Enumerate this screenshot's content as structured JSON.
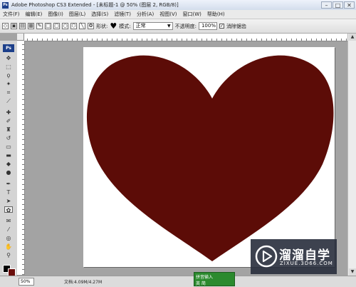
{
  "window": {
    "title": "Adobe Photoshop CS3 Extended - [未标题-1 @ 50% (图层 2, RGB/8)]",
    "logo_text": "Ps",
    "controls": [
      "–",
      "□",
      "✕"
    ]
  },
  "menu": [
    "文件(F)",
    "编辑(E)",
    "图像(I)",
    "图层(L)",
    "选择(S)",
    "滤镜(T)",
    "分析(A)",
    "视图(V)",
    "窗口(W)",
    "帮助(H)"
  ],
  "options": {
    "shape_label": "形状:",
    "mode_label": "模式:",
    "mode_value": "正常",
    "opacity_label": "不透明度:",
    "opacity_value": "100%",
    "antialias_label": "消除锯齿"
  },
  "toolbox": {
    "logo_text": "Ps"
  },
  "colors": {
    "heart": "#5c0c07",
    "foreground": "#000000",
    "background": "#6b0e0c"
  },
  "status": {
    "zoom": "50%",
    "doc": "文档:4.09M/4.27M"
  },
  "ime": {
    "line1": "拼音输入",
    "line2": "英 简"
  },
  "watermark": {
    "title": "溜溜自学",
    "url": "ZIXUE.3D66.COM"
  }
}
